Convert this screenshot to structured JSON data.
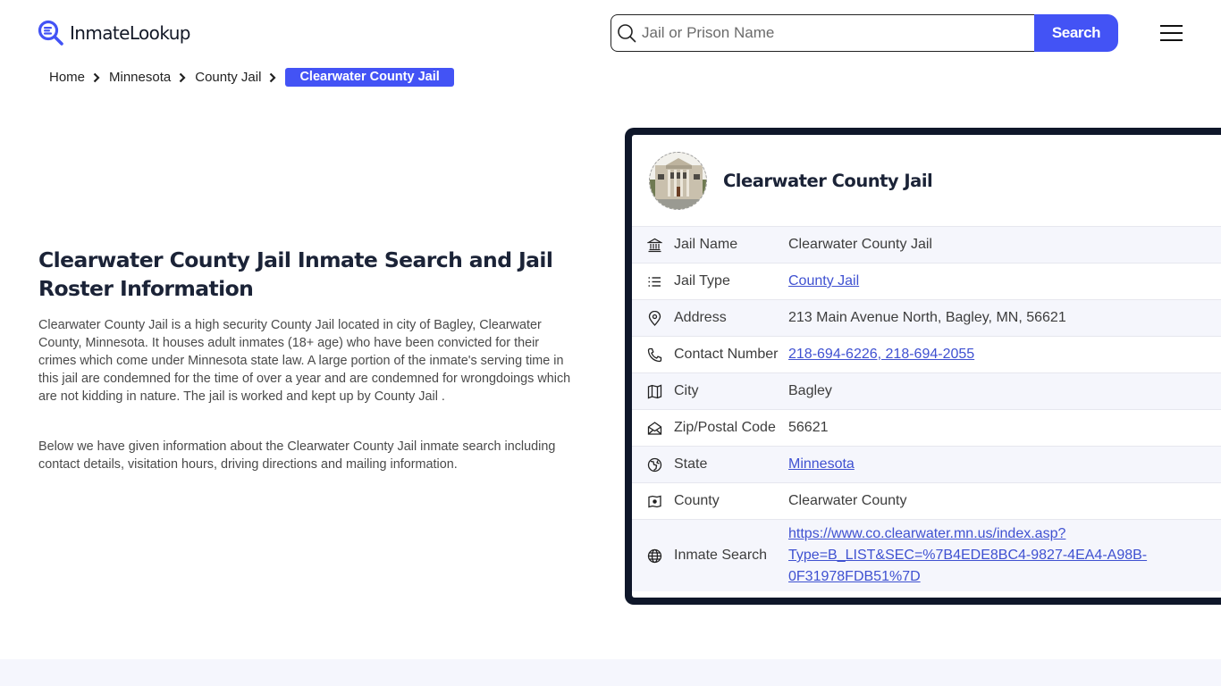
{
  "header": {
    "logo_text": "InmateLookup",
    "search": {
      "placeholder": "Jail or Prison Name",
      "value": "",
      "button_label": "Search"
    },
    "menu_icon": "hamburger-icon"
  },
  "breadcrumb": {
    "items": [
      "Home",
      "Minnesota",
      "County Jail"
    ],
    "current": "Clearwater County Jail",
    "separator_icon": "chevron-right-icon"
  },
  "main": {
    "title": "Clearwater County Jail Inmate Search and Jail Roster Information",
    "paragraphs": [
      "Clearwater County Jail is a high security County Jail located in city of Bagley, Clearwater County, Minnesota. It houses adult inmates (18+ age) who have been convicted for their crimes which come under Minnesota state law. A large portion of the inmate's serving time in this jail are condemned for the time of over a year and are condemned for wrongdoings which are not kidding in nature. The jail is worked and kept up by County Jail .",
      "Below we have given information about the Clearwater County Jail inmate search including contact details, visitation hours, driving directions and mailing information."
    ]
  },
  "card": {
    "title": "Clearwater County Jail",
    "accent": "#0f172a",
    "rows": [
      {
        "icon": "bank-icon",
        "label": "Jail Name",
        "value": "Clearwater County Jail",
        "link": false
      },
      {
        "icon": "list-icon",
        "label": "Jail Type",
        "value": "County Jail",
        "link": true
      },
      {
        "icon": "map-pin-icon",
        "label": "Address",
        "value": "213 Main Avenue North, Bagley, MN, 56621",
        "link": false
      },
      {
        "icon": "phone-icon",
        "label": "Contact Number",
        "value": "218-694-6226, 218-694-2055",
        "link": true
      },
      {
        "icon": "map-icon",
        "label": "City",
        "value": "Bagley",
        "link": false
      },
      {
        "icon": "mail-open-icon",
        "label": "Zip/Postal Code",
        "value": "56621",
        "link": false
      },
      {
        "icon": "globe-state-icon",
        "label": "State",
        "value": "Minnesota",
        "link": true
      },
      {
        "icon": "county-map-icon",
        "label": "County",
        "value": "Clearwater County",
        "link": false
      },
      {
        "icon": "globe-icon",
        "label": "Inmate Search",
        "value_lines": [
          "https://www.co.clearwater.mn.us/index.asp?",
          "Type=B_LIST&SEC=%7B4EDE8BC4-9827-4EA4-A98B-",
          "0F31978FDB51%7D"
        ],
        "link": true
      }
    ]
  },
  "colors": {
    "brand": "#4353f5",
    "link": "#3f51d1",
    "heading": "#1b2337",
    "row_alt": "#f5f6fc"
  }
}
